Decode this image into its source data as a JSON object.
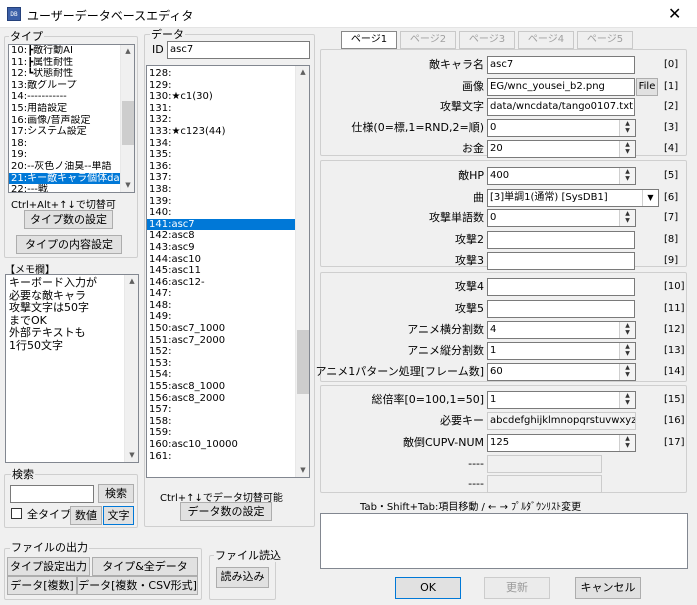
{
  "window": {
    "title": "ユーザーデータベースエディタ",
    "close": "✕"
  },
  "type_panel": {
    "label": "タイプ",
    "items": [
      "10:┣敵行動AI",
      "11:┣属性耐性",
      "12:┗状態耐性",
      "13:敵グループ",
      "14:-----------",
      "15:用語設定",
      "16:画像/音声設定",
      "17:システム設定",
      "18:",
      "19:",
      "20:--灰色ノ油臭--単語",
      "21:キー敵キャラ個体data",
      "22:---戦"
    ],
    "selected_index": 11,
    "hint": "Ctrl+Alt+↑↓で切替可",
    "count_button": "タイプ数の設定",
    "content_button": "タイプの内容設定"
  },
  "memo": {
    "label": "【メモ欄】",
    "lines": [
      "キーボード入力が",
      "必要な敵キャラ",
      "攻撃文字は50字",
      "までOK",
      "外部テキストも",
      "1行50文字"
    ]
  },
  "search": {
    "label": "検索",
    "button": "検索",
    "all_types_label": "全タイプ",
    "numeric_btn": "数値",
    "text_btn": "文字"
  },
  "file_output": {
    "label": "ファイルの出力",
    "btn1": "タイプ設定出力",
    "btn2": "タイプ&全データ",
    "btn3": "データ[複数]",
    "btn4": "データ[複数・CSV形式]"
  },
  "file_read": {
    "label": "ファイル読込",
    "btn": "読み込み"
  },
  "data_panel": {
    "label": "データ",
    "id_label": "ID",
    "id_value": "asc7",
    "items": [
      "128:",
      "129:",
      "130:★c1(30)",
      "131:",
      "132:",
      "133:★c123(44)",
      "134:",
      "135:",
      "136:",
      "137:",
      "138:",
      "139:",
      "140:",
      "141:asc7",
      "142:asc8",
      "143:asc9",
      "144:asc10",
      "145:asc11",
      "146:asc12-",
      "147:",
      "148:",
      "149:",
      "150:asc7_1000",
      "151:asc7_2000",
      "152:",
      "153:",
      "154:",
      "155:asc8_1000",
      "156:asc8_2000",
      "157:",
      "158:",
      "159:",
      "160:asc10_10000",
      "161:"
    ],
    "selected_index": 13,
    "hint": "Ctrl+↑↓でデータ切替可能",
    "count_button": "データ数の設定"
  },
  "tabs": [
    "ページ1",
    "ページ2",
    "ページ3",
    "ページ4",
    "ページ5"
  ],
  "fields": [
    {
      "label": "敵キャラ名",
      "value": "asc7",
      "index": "[0]"
    },
    {
      "label": "画像",
      "value": "EG/wnc_yousei_b2.png",
      "index": "[1]",
      "button": "File"
    },
    {
      "label": "攻撃文字",
      "value": "data/wncdata/tango0107.txt",
      "index": "[2]"
    },
    {
      "label": "仕様(0=標,1=RND,2=順)",
      "value": "0",
      "index": "[3]"
    },
    {
      "label": "お金",
      "value": "20",
      "index": "[4]"
    },
    {
      "label": "敵HP",
      "value": "400",
      "index": "[5]"
    },
    {
      "label": "曲",
      "value": "[3]単調1(通常) [SysDB1]",
      "index": "[6]"
    },
    {
      "label": "攻撃単語数",
      "value": "0",
      "index": "[7]"
    },
    {
      "label": "攻撃2",
      "value": "",
      "index": "[8]"
    },
    {
      "label": "攻撃3",
      "value": "",
      "index": "[9]"
    },
    {
      "label": "攻撃4",
      "value": "",
      "index": "[10]"
    },
    {
      "label": "攻撃5",
      "value": "",
      "index": "[11]"
    },
    {
      "label": "アニメ横分割数",
      "value": "4",
      "index": "[12]"
    },
    {
      "label": "アニメ縦分割数",
      "value": "1",
      "index": "[13]"
    },
    {
      "label": "アニメ1パターン処理[フレーム数]",
      "value": "60",
      "index": "[14]"
    },
    {
      "label": "総倍率[0=100,1=50]",
      "value": "1",
      "index": "[15]"
    },
    {
      "label": "必要キー",
      "value": "abcdefghijklmnopqrstuvwxyz",
      "index": "[16]"
    },
    {
      "label": "敵倒CUPV-NUM",
      "value": "125",
      "index": "[17]"
    },
    {
      "label": "----",
      "value": "",
      "index": ""
    },
    {
      "label": "----",
      "value": "",
      "index": ""
    }
  ],
  "footer_hint": "Tab・Shift+Tab:項目移動 / ← → ﾌﾟﾙﾀﾞｳﾝﾘｽﾄ変更",
  "buttons": {
    "ok": "OK",
    "update": "更新",
    "cancel": "キャンセル"
  },
  "colors": {
    "selection": "#0078d7",
    "window": "#f0f0f0"
  }
}
